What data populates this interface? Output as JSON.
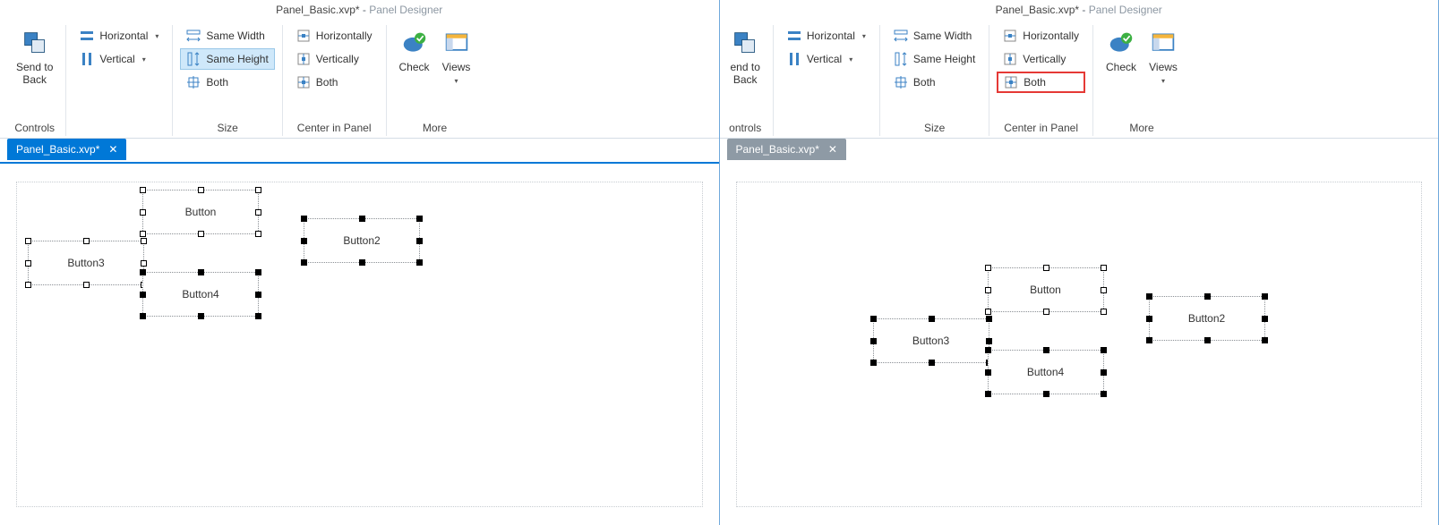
{
  "left": {
    "title_file": "Panel_Basic.xvp*",
    "title_app": "Panel Designer",
    "tab_label": "Panel_Basic.xvp*",
    "groups": {
      "controls": {
        "label": "Controls",
        "send_to_back": "Send to\nBack"
      },
      "align": {
        "horizontal": "Horizontal",
        "vertical": "Vertical"
      },
      "size": {
        "label": "Size",
        "same_width": "Same Width",
        "same_height": "Same Height",
        "both": "Both"
      },
      "center": {
        "label": "Center in Panel",
        "horizontally": "Horizontally",
        "vertically": "Vertically",
        "both": "Both"
      },
      "more": {
        "label": "More",
        "check": "Check",
        "views": "Views"
      }
    },
    "buttons": {
      "b1": "Button",
      "b2": "Button2",
      "b3": "Button3",
      "b4": "Button4"
    }
  },
  "right": {
    "title_file": "Panel_Basic.xvp*",
    "title_app": "Panel Designer",
    "tab_label": "Panel_Basic.xvp*",
    "groups": {
      "controls": {
        "label": "ontrols",
        "send_to_back": "end to\nBack"
      },
      "align": {
        "horizontal": "Horizontal",
        "vertical": "Vertical"
      },
      "size": {
        "label": "Size",
        "same_width": "Same Width",
        "same_height": "Same Height",
        "both": "Both"
      },
      "center": {
        "label": "Center in Panel",
        "horizontally": "Horizontally",
        "vertically": "Vertically",
        "both": "Both"
      },
      "more": {
        "label": "More",
        "check": "Check",
        "views": "Views"
      }
    },
    "buttons": {
      "b1": "Button",
      "b2": "Button2",
      "b3": "Button3",
      "b4": "Button4"
    }
  }
}
